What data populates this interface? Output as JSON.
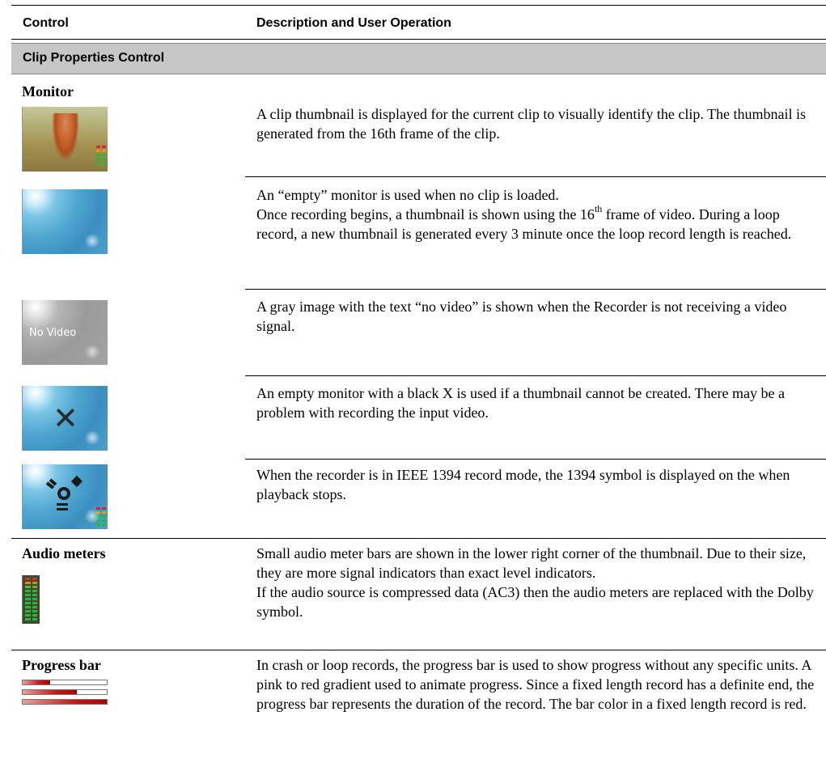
{
  "header": {
    "control": "Control",
    "description": "Description and User Operation"
  },
  "section": {
    "title": "Clip Properties Control"
  },
  "monitor": {
    "label": "Monitor",
    "rows": [
      {
        "icon": "child-photo-thumbnail",
        "text": "A clip thumbnail is displayed for the current clip to visually identify the clip. The thumbnail is generated from the 16th frame of the clip."
      },
      {
        "icon": "empty-monitor-thumbnail",
        "line1": "An “empty” monitor is used when no clip is loaded.",
        "line2_pre": "Once recording begins, a thumbnail is shown using the 16",
        "line2_sup": "th",
        "line2_post": " frame of video. During a loop record, a new thumbnail is generated every 3 minute once the loop record length is reached."
      },
      {
        "icon": "no-video-thumbnail",
        "overlay": "No Video",
        "text": "A gray image with the text “no video” is shown when the Recorder is not receiving a video signal."
      },
      {
        "icon": "black-x-thumbnail",
        "text": "An empty monitor with a black X is used if a thumbnail cannot be created. There may be a problem with recording the input video."
      },
      {
        "icon": "ieee-1394-thumbnail",
        "text": "When the recorder is in IEEE 1394 record mode, the 1394 symbol is displayed on the when playback stops."
      }
    ]
  },
  "audio": {
    "label": "Audio meters",
    "icon": "audio-meter-icon",
    "line1": "Small audio meter bars are shown in the lower right corner of the thumbnail. Due to their size, they are more signal indicators than exact level indicators.",
    "line2": "If the audio source is compressed data (AC3) then the audio meters are replaced with the Dolby symbol."
  },
  "progress": {
    "label": "Progress bar",
    "icon": "progress-bar-icon",
    "levels": [
      0.33,
      0.64,
      1.0
    ],
    "text": "In crash or loop records, the progress bar is used to show progress without any specific units. A pink to red gradient used to animate progress. Since a fixed length record has a definite end, the progress bar represents the duration of the record. The bar color in a fixed length record is red."
  },
  "colors": {
    "section_bg": "#c6c6c6",
    "thumb_blue": "#4fa6d0",
    "progress_red": "#c61a1a",
    "meter_green": "#22b830"
  }
}
